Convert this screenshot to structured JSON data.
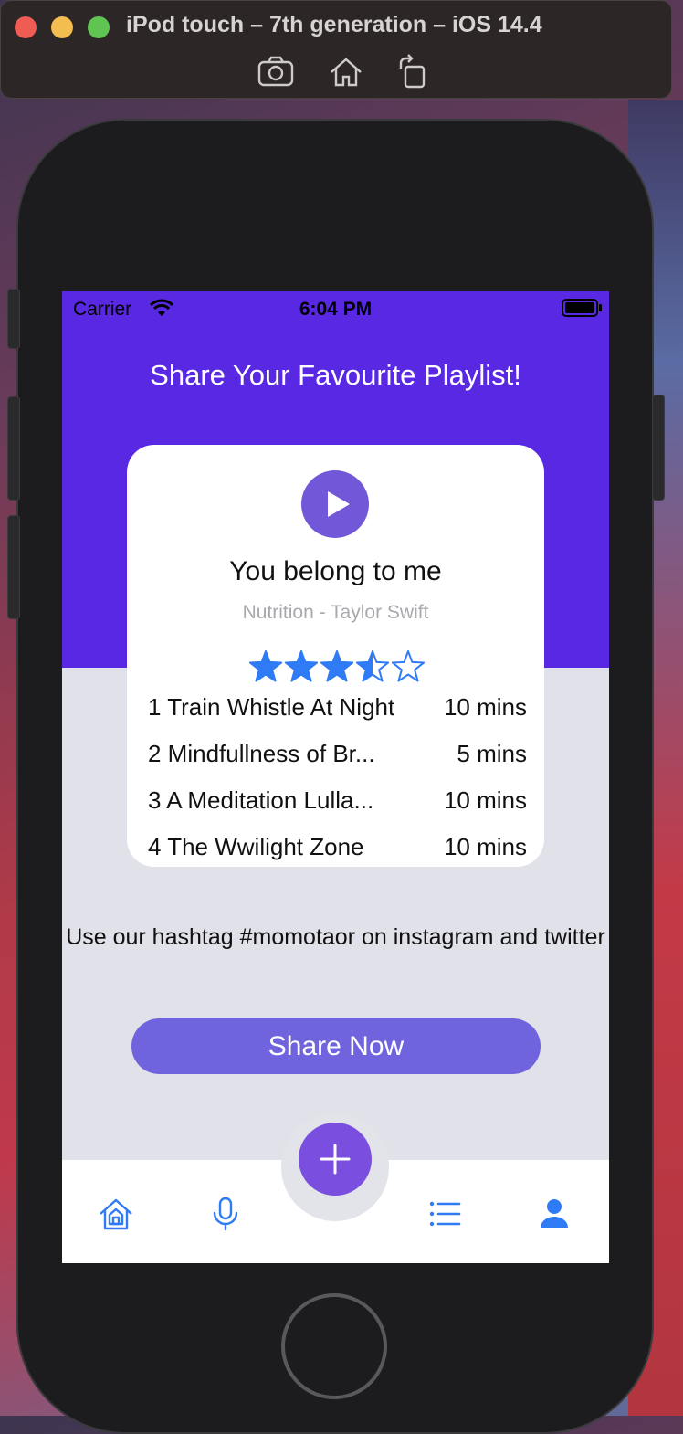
{
  "simulator": {
    "title": "iPod touch – 7th generation – iOS 14.4",
    "buttons": [
      "screenshot-icon",
      "home-icon",
      "rotate-icon"
    ]
  },
  "status_bar": {
    "carrier": "Carrier",
    "time": "6:04 PM"
  },
  "header": {
    "title": "Share Your Favourite Playlist!"
  },
  "player_card": {
    "song_title": "You belong to me",
    "subtitle": "Nutrition - Taylor Swift",
    "rating": 3.5,
    "rating_max": 5,
    "tracks": [
      {
        "name": "1 Train Whistle At Night",
        "duration": "10 mins"
      },
      {
        "name": "2 Mindfullness of Br...",
        "duration": "5 mins"
      },
      {
        "name": "3 A Meditation Lulla...",
        "duration": "10 mins"
      },
      {
        "name": "4 The Wwilight Zone",
        "duration": "10 mins"
      }
    ]
  },
  "hashtag_text": "Use our hashtag #momotaor on instagram and twitter",
  "share_button": "Share Now",
  "tab_bar": {
    "items": [
      "home-icon",
      "mic-icon",
      "add-icon",
      "list-icon",
      "profile-icon"
    ]
  },
  "colors": {
    "header_bg": "#5828e3",
    "accent": "#7258d8",
    "share_button": "#6f63de",
    "tab_icon": "#2f7bf5",
    "star": "#2f7bf5"
  }
}
